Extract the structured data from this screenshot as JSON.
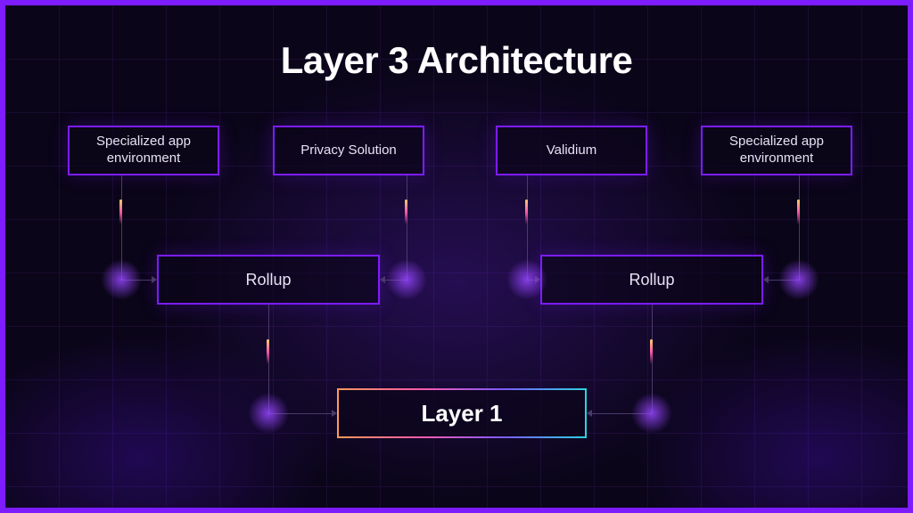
{
  "title": "Layer 3 Architecture",
  "layer3": {
    "a": "Specialized app environment",
    "b": "Privacy Solution",
    "c": "Validium",
    "d": "Specialized app environment"
  },
  "layer2": {
    "left": "Rollup",
    "right": "Rollup"
  },
  "layer1": "Layer 1",
  "colors": {
    "accent": "#7c1cff",
    "gradient": [
      "#ff9a5a",
      "#ff5aa9",
      "#7c5aff",
      "#2ad4e0"
    ]
  }
}
